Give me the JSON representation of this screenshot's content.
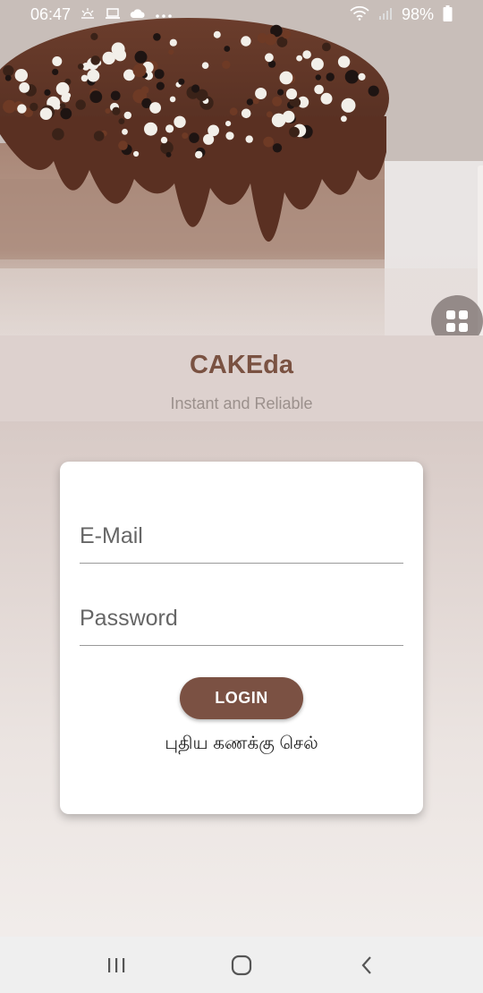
{
  "status_bar": {
    "time": "06:47",
    "battery": "98%",
    "icons": [
      "sunrise-icon",
      "laptop-icon",
      "cloud-icon",
      "more-dots-icon",
      "wifi-icon",
      "signal-icon",
      "battery-icon"
    ]
  },
  "brand": {
    "title": "CAKEda",
    "subtitle": "Instant and Reliable"
  },
  "login_form": {
    "email_placeholder": "E-Mail",
    "password_placeholder": "Password",
    "login_label": "LOGIN",
    "register_link": "புதிய கணக்கு செல்"
  },
  "colors": {
    "accent": "#7b5143",
    "title": "#7a5242",
    "subtitle": "#9b908c"
  },
  "nav_bar": {
    "icons": [
      "recent-apps-icon",
      "home-icon",
      "back-icon"
    ]
  }
}
